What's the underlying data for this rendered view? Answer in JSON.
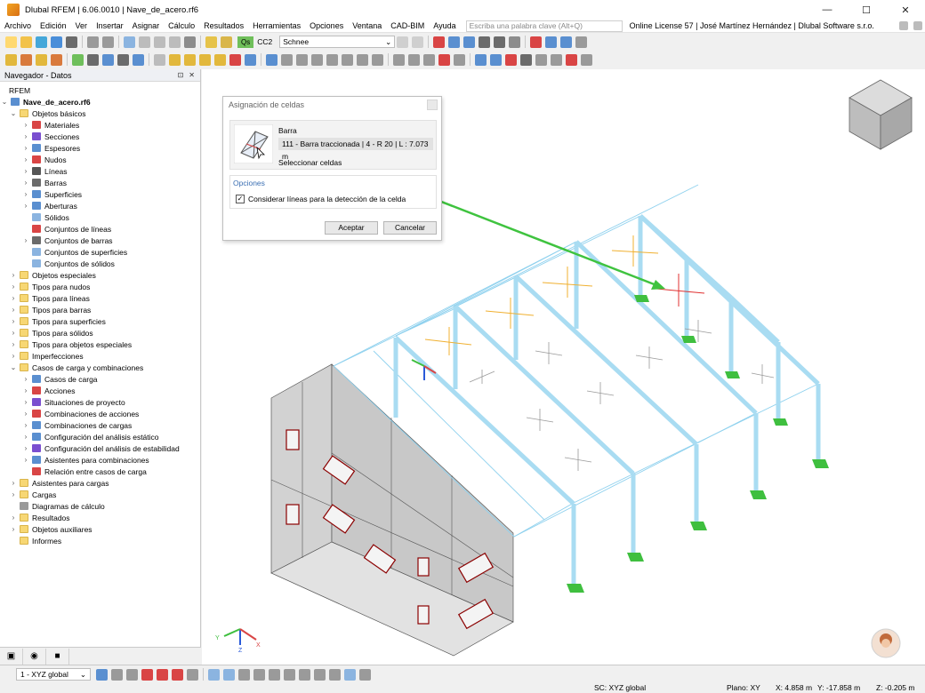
{
  "window": {
    "title": "Dlubal RFEM | 6.06.0010 | Nave_de_acero.rf6",
    "minimize": "—",
    "maximize": "☐",
    "close": "✕"
  },
  "menu": {
    "items": [
      "Archivo",
      "Edición",
      "Ver",
      "Insertar",
      "Asignar",
      "Cálculo",
      "Resultados",
      "Herramientas",
      "Opciones",
      "Ventana",
      "CAD-BIM",
      "Ayuda"
    ],
    "search_placeholder": "Escriba una palabra clave (Alt+Q)",
    "license": "Online License 57 | José Martínez Hernández | Dlubal Software s.r.o."
  },
  "toolbar": {
    "load_badge": "Qs",
    "load_case": "CC2",
    "load_name": "Schnee"
  },
  "navigator": {
    "title": "Navegador - Datos",
    "root": "RFEM",
    "file": "Nave_de_acero.rf6",
    "items": [
      {
        "label": "Objetos básicos",
        "level": 1,
        "chev": "⌄",
        "icon": "folder-icon"
      },
      {
        "label": "Materiales",
        "level": 2,
        "chev": "›",
        "icon": "materials-icon"
      },
      {
        "label": "Secciones",
        "level": 2,
        "chev": "›",
        "icon": "sections-icon"
      },
      {
        "label": "Espesores",
        "level": 2,
        "chev": "›",
        "icon": "thickness-icon"
      },
      {
        "label": "Nudos",
        "level": 2,
        "chev": "›",
        "icon": "nodes-icon"
      },
      {
        "label": "Líneas",
        "level": 2,
        "chev": "›",
        "icon": "lines-icon"
      },
      {
        "label": "Barras",
        "level": 2,
        "chev": "›",
        "icon": "members-icon"
      },
      {
        "label": "Superficies",
        "level": 2,
        "chev": "›",
        "icon": "surfaces-icon"
      },
      {
        "label": "Aberturas",
        "level": 2,
        "chev": "›",
        "icon": "openings-icon"
      },
      {
        "label": "Sólidos",
        "level": 2,
        "chev": "",
        "icon": "solids-icon"
      },
      {
        "label": "Conjuntos de líneas",
        "level": 2,
        "chev": "",
        "icon": "line-sets-icon"
      },
      {
        "label": "Conjuntos de barras",
        "level": 2,
        "chev": "›",
        "icon": "member-sets-icon"
      },
      {
        "label": "Conjuntos de superficies",
        "level": 2,
        "chev": "",
        "icon": "surface-sets-icon"
      },
      {
        "label": "Conjuntos de sólidos",
        "level": 2,
        "chev": "",
        "icon": "solid-sets-icon"
      },
      {
        "label": "Objetos especiales",
        "level": 1,
        "chev": "›",
        "icon": "folder-icon"
      },
      {
        "label": "Tipos para nudos",
        "level": 1,
        "chev": "›",
        "icon": "folder-icon"
      },
      {
        "label": "Tipos para líneas",
        "level": 1,
        "chev": "›",
        "icon": "folder-icon"
      },
      {
        "label": "Tipos para barras",
        "level": 1,
        "chev": "›",
        "icon": "folder-icon"
      },
      {
        "label": "Tipos para superficies",
        "level": 1,
        "chev": "›",
        "icon": "folder-icon"
      },
      {
        "label": "Tipos para sólidos",
        "level": 1,
        "chev": "›",
        "icon": "folder-icon"
      },
      {
        "label": "Tipos para objetos especiales",
        "level": 1,
        "chev": "›",
        "icon": "folder-icon"
      },
      {
        "label": "Imperfecciones",
        "level": 1,
        "chev": "›",
        "icon": "folder-icon"
      },
      {
        "label": "Casos de carga y combinaciones",
        "level": 1,
        "chev": "⌄",
        "icon": "folder-icon"
      },
      {
        "label": "Casos de carga",
        "level": 2,
        "chev": "›",
        "icon": "load-cases-icon"
      },
      {
        "label": "Acciones",
        "level": 2,
        "chev": "›",
        "icon": "actions-icon"
      },
      {
        "label": "Situaciones de proyecto",
        "level": 2,
        "chev": "›",
        "icon": "design-situations-icon"
      },
      {
        "label": "Combinaciones de acciones",
        "level": 2,
        "chev": "›",
        "icon": "action-combinations-icon"
      },
      {
        "label": "Combinaciones de cargas",
        "level": 2,
        "chev": "›",
        "icon": "load-combinations-icon"
      },
      {
        "label": "Configuración del análisis estático",
        "level": 2,
        "chev": "›",
        "icon": "static-analysis-icon"
      },
      {
        "label": "Configuración del análisis de estabilidad",
        "level": 2,
        "chev": "›",
        "icon": "stability-analysis-icon"
      },
      {
        "label": "Asistentes para combinaciones",
        "level": 2,
        "chev": "›",
        "icon": "combination-wizard-icon"
      },
      {
        "label": "Relación entre casos de carga",
        "level": 2,
        "chev": "",
        "icon": "relationship-icon"
      },
      {
        "label": "Asistentes para cargas",
        "level": 1,
        "chev": "›",
        "icon": "folder-icon"
      },
      {
        "label": "Cargas",
        "level": 1,
        "chev": "›",
        "icon": "folder-icon"
      },
      {
        "label": "Diagramas de cálculo",
        "level": 1,
        "chev": "",
        "icon": "diagrams-icon"
      },
      {
        "label": "Resultados",
        "level": 1,
        "chev": "›",
        "icon": "folder-icon"
      },
      {
        "label": "Objetos auxiliares",
        "level": 1,
        "chev": "›",
        "icon": "folder-icon"
      },
      {
        "label": "Informes",
        "level": 1,
        "chev": "",
        "icon": "folder-icon"
      }
    ]
  },
  "dialog": {
    "title": "Asignación de celdas",
    "bar_label": "Barra",
    "bar_value": "111 - Barra traccionada | 4 - R 20 | L : 7.073 m",
    "select_cells": "Seleccionar celdas",
    "options_title": "Opciones",
    "checkbox_label": "Considerar líneas para la detección de la celda",
    "checkbox_checked": true,
    "ok": "Aceptar",
    "cancel": "Cancelar"
  },
  "statusbar": {
    "view": "1 - XYZ global",
    "cs": "SC: XYZ global",
    "plane": "Plano: XY",
    "x": "X: 4.858 m",
    "y": "Y: -17.858 m",
    "z": "Z: -0.205 m"
  },
  "colors": {
    "member": "#a9dcf2",
    "support": "#3fbf3f",
    "arrow": "#3fc33f",
    "wall": "#c8c8c8"
  }
}
